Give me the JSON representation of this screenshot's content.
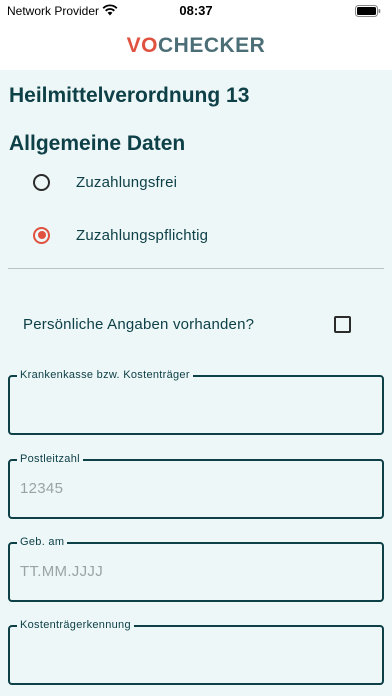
{
  "status_bar": {
    "carrier": "Network Provider",
    "time": "08:37"
  },
  "header": {
    "logo_accent": "VO",
    "logo_rest": "CHECKER"
  },
  "page": {
    "title": "Heilmittelverordnung 13",
    "section_title": "Allgemeine Daten"
  },
  "payment_options": [
    {
      "label": "Zuzahlungsfrei",
      "selected": false
    },
    {
      "label": "Zuzahlungspflichtig",
      "selected": true
    }
  ],
  "personal_data": {
    "label": "Persönliche Angaben vorhanden?",
    "checked": false
  },
  "fields": [
    {
      "label": "Krankenkasse bzw. Kostenträger",
      "placeholder": ""
    },
    {
      "label": "Postleitzahl",
      "placeholder": "12345"
    },
    {
      "label": "Geb. am",
      "placeholder": "TT.MM.JJJJ"
    },
    {
      "label": "Kostenträgerkennung",
      "placeholder": ""
    }
  ],
  "colors": {
    "accent": "#e0523f",
    "primary": "#0e4048",
    "background": "#eef7f7"
  }
}
